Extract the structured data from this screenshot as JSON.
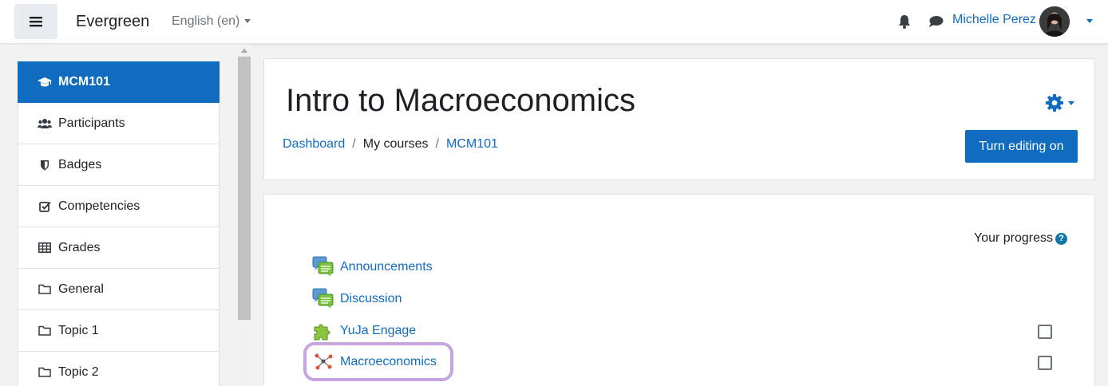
{
  "navbar": {
    "site_name": "Evergreen",
    "language": "English (en)",
    "user_name": "Michelle Perez"
  },
  "drawer": {
    "items": [
      {
        "label": "MCM101",
        "icon": "graduation-cap-icon",
        "active": true
      },
      {
        "label": "Participants",
        "icon": "users-icon"
      },
      {
        "label": "Badges",
        "icon": "shield-icon"
      },
      {
        "label": "Competencies",
        "icon": "check-square-icon"
      },
      {
        "label": "Grades",
        "icon": "table-icon"
      },
      {
        "label": "General",
        "icon": "folder-icon"
      },
      {
        "label": "Topic 1",
        "icon": "folder-icon"
      },
      {
        "label": "Topic 2",
        "icon": "folder-icon"
      }
    ]
  },
  "header": {
    "title": "Intro to Macroeconomics",
    "breadcrumb": [
      "Dashboard",
      "My courses",
      "MCM101"
    ],
    "edit_button": "Turn editing on"
  },
  "content": {
    "progress_label": "Your progress",
    "activities": [
      {
        "label": "Announcements",
        "icon": "forum-icon",
        "has_checkbox": false
      },
      {
        "label": "Discussion",
        "icon": "forum-icon",
        "has_checkbox": false
      },
      {
        "label": "YuJa Engage",
        "icon": "puzzle-icon",
        "has_checkbox": true
      },
      {
        "label": "Macroeconomics",
        "icon": "mindmap-icon",
        "has_checkbox": true,
        "highlighted": true
      }
    ]
  },
  "colors": {
    "primary": "#0f6cbf",
    "highlight": "#c6a5e0"
  }
}
